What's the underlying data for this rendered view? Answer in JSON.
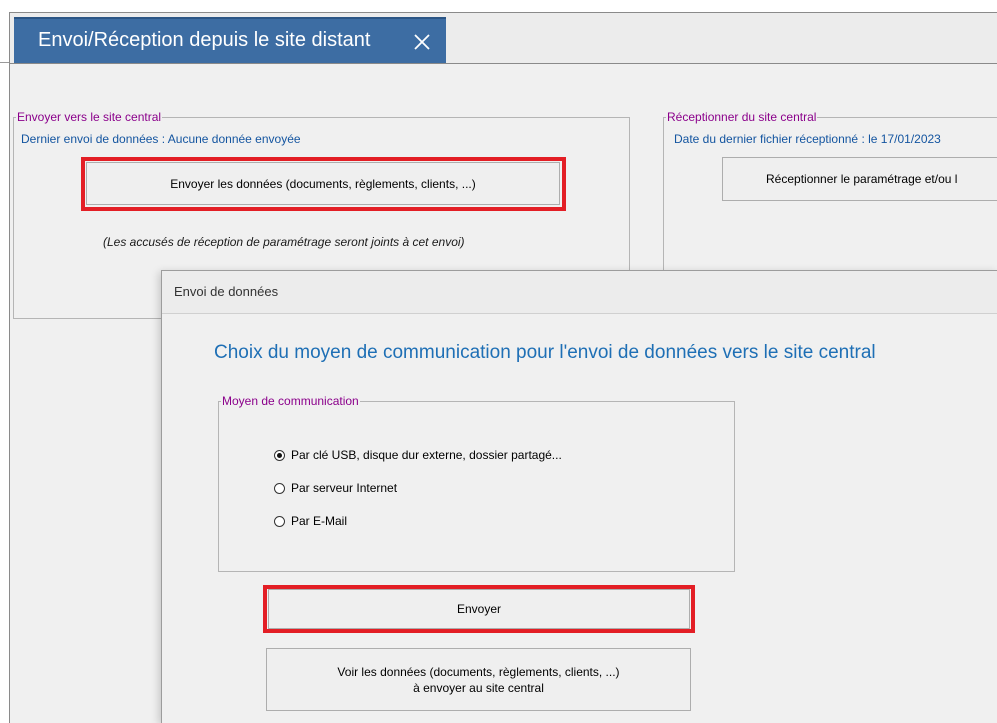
{
  "window": {
    "tab_title": "Envoi/Réception depuis le site distant"
  },
  "send_group": {
    "legend": "Envoyer vers le site central",
    "last_send": "Dernier envoi de données : Aucune donnée envoyée",
    "send_button": "Envoyer les données (documents, règlements, clients, ...)",
    "note": "(Les accusés de réception de paramétrage seront joints à cet envoi)"
  },
  "receive_group": {
    "legend": "Réceptionner du site central",
    "last_file": "Date du dernier fichier réceptionné : le 17/01/2023",
    "receive_button": "Réceptionner le paramétrage et/ou l"
  },
  "dialog": {
    "title": "Envoi de données",
    "heading": "Choix du moyen de communication pour l'envoi de données vers le site central",
    "comm_legend": "Moyen de communication",
    "options": [
      {
        "label": "Par clé USB, disque dur externe, dossier partagé...",
        "checked": true
      },
      {
        "label": "Par serveur Internet",
        "checked": false
      },
      {
        "label": "Par E-Mail",
        "checked": false
      }
    ],
    "send_button": "Envoyer",
    "view_button_line1": "Voir les données (documents, règlements, clients, ...)",
    "view_button_line2": "à envoyer au site central"
  },
  "colors": {
    "tab_bg": "#3d6da3",
    "legend_text": "#8b008b",
    "info_text": "#1455a0",
    "heading_text": "#1e6fb5",
    "highlight": "#e31e25"
  },
  "icons": {
    "tab_close": "close-icon"
  }
}
